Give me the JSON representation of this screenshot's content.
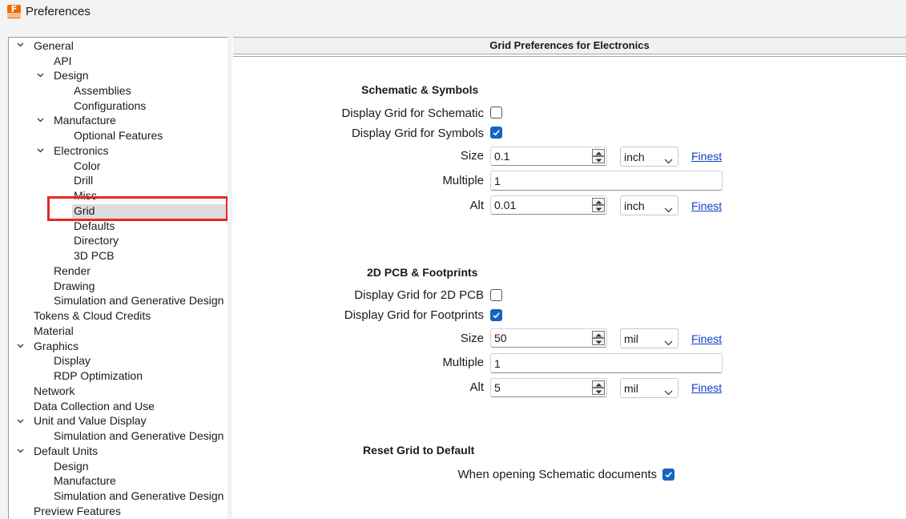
{
  "window": {
    "title": "Preferences",
    "app_icon_letter": "F"
  },
  "tree": {
    "items": [
      {
        "label": "General"
      },
      {
        "label": "API"
      },
      {
        "label": "Design"
      },
      {
        "label": "Assemblies"
      },
      {
        "label": "Configurations"
      },
      {
        "label": "Manufacture"
      },
      {
        "label": "Optional Features"
      },
      {
        "label": "Electronics"
      },
      {
        "label": "Color"
      },
      {
        "label": "Drill"
      },
      {
        "label": "Misc"
      },
      {
        "label": "Grid"
      },
      {
        "label": "Defaults"
      },
      {
        "label": "Directory"
      },
      {
        "label": "3D PCB"
      },
      {
        "label": "Render"
      },
      {
        "label": "Drawing"
      },
      {
        "label": "Simulation and Generative Design"
      },
      {
        "label": "Tokens & Cloud Credits"
      },
      {
        "label": "Material"
      },
      {
        "label": "Graphics"
      },
      {
        "label": "Display"
      },
      {
        "label": "RDP Optimization"
      },
      {
        "label": "Network"
      },
      {
        "label": "Data Collection and Use"
      },
      {
        "label": "Unit and Value Display"
      },
      {
        "label": "Simulation and Generative Design"
      },
      {
        "label": "Default Units"
      },
      {
        "label": "Design"
      },
      {
        "label": "Manufacture"
      },
      {
        "label": "Simulation and Generative Design"
      },
      {
        "label": "Preview Features"
      }
    ],
    "selected": "Grid"
  },
  "panel": {
    "header": "Grid Preferences for Electronics",
    "schematic": {
      "title": "Schematic & Symbols",
      "display_schematic_label": "Display Grid for Schematic",
      "display_schematic_checked": false,
      "display_symbols_label": "Display Grid for Symbols",
      "display_symbols_checked": true,
      "size_label": "Size",
      "size_value": "0.1",
      "size_unit": "inch",
      "size_finest": "Finest",
      "multiple_label": "Multiple",
      "multiple_value": "1",
      "alt_label": "Alt",
      "alt_value": "0.01",
      "alt_unit": "inch",
      "alt_finest": "Finest"
    },
    "pcb": {
      "title": "2D PCB & Footprints",
      "display_pcb_label": "Display Grid for 2D PCB",
      "display_pcb_checked": false,
      "display_footprints_label": "Display Grid for Footprints",
      "display_footprints_checked": true,
      "size_label": "Size",
      "size_value": "50",
      "size_unit": "mil",
      "size_finest": "Finest",
      "multiple_label": "Multiple",
      "multiple_value": "1",
      "alt_label": "Alt",
      "alt_value": "5",
      "alt_unit": "mil",
      "alt_finest": "Finest"
    },
    "reset": {
      "title": "Reset Grid to Default",
      "when_opening_label": "When opening Schematic documents",
      "when_opening_checked": true
    }
  },
  "colors": {
    "accent": "#1565c0",
    "highlight": "#e8262a",
    "link": "#0c41c9",
    "brand": "#ef6c00"
  }
}
